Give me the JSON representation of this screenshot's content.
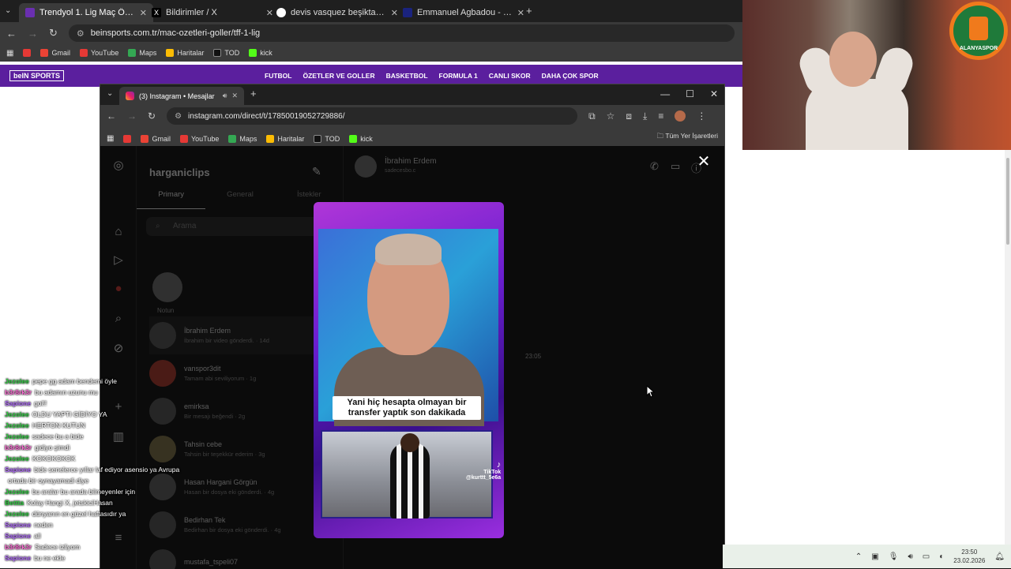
{
  "bg_browser": {
    "tabs": [
      {
        "title": "Trendyol 1. Lig Maç Özetleri ve",
        "color": "#6a2fb0"
      },
      {
        "title": "Bildirimler / X",
        "color": "#000000"
      },
      {
        "title": "devis vasquez beşiktaş - Googl",
        "color": "#4285f4"
      },
      {
        "title": "Emmanuel Agbadou - Oyuncu",
        "color": "#1a237e"
      }
    ],
    "url": "beinsports.com.tr/mac-ozetleri-goller/tff-1-lig",
    "bookmarks": [
      "Gmail",
      "YouTube",
      "Maps",
      "Haritalar",
      "TOD",
      "kick"
    ],
    "site_logo": "beIN SPORTS",
    "nav": [
      "FUTBOL",
      "ÖZETLER VE GOLLER",
      "BASKETBOL",
      "FORMULA 1",
      "CANLI SKOR",
      "DAHA ÇOK SPOR"
    ]
  },
  "ig_window": {
    "tab_title": "(3) Instagram • Mesajlar",
    "url": "instagram.com/direct/t/17850019052729886/",
    "bookmarks": [
      "Gmail",
      "YouTube",
      "Maps",
      "Haritalar",
      "TOD",
      "kick"
    ],
    "all_bookmarks": "Tüm Yer İşaretleri",
    "username": "harganiclips",
    "tabs": [
      "Primary",
      "General",
      "İstekler"
    ],
    "search_placeholder": "Arama",
    "notes_label": "Notun",
    "conversations": [
      {
        "name": "İbrahim Erdem",
        "snippet": "İbrahim bir video gönderdi. · 14d"
      },
      {
        "name": "vanspor3dit",
        "snippet": "Tamam abi seviliyorum · 1g"
      },
      {
        "name": "emirksa",
        "snippet": "Bir mesajı beğendi · 2g"
      },
      {
        "name": "Tahsin cebe",
        "snippet": "Tahsin bir teşekkür ederim · 3g"
      },
      {
        "name": "Hasan Hargani Görgün",
        "snippet": "Hasan bir dosya eki gönderdi. · 4g"
      },
      {
        "name": "Bedirhan Tek",
        "snippet": "Bedirhan bir dosya eki gönderdi. · 4g"
      },
      {
        "name": "mustafa_tspeli07",
        "snippet": ""
      }
    ],
    "chat_name": "İbrahim Erdem",
    "chat_sub": "sadecesbo.c",
    "timestamp": "23:05"
  },
  "video": {
    "caption": "Yani hiç hesapta olmayan bir transfer yaptık son dakikada",
    "tiktok_label": "TikTok",
    "tiktok_user": "@kurttt_5e6a"
  },
  "chat": [
    {
      "user": "Jezolee",
      "color": "#2ecc40",
      "msg": "pepe gg adam bendemi öyle"
    },
    {
      "user": "b3r8rk3r",
      "color": "#ff6bd6",
      "msg": "bu adamın uzunu mu"
    },
    {
      "user": "Sapione",
      "color": "#b36cff",
      "msg": "gol!!"
    },
    {
      "user": "Jezolee",
      "color": "#2ecc40",
      "msg": "OLDU YAPTI GİDİYO YA"
    },
    {
      "user": "Jezolee",
      "color": "#2ecc40",
      "msg": "HERTON KUTUN"
    },
    {
      "user": "Jezolee",
      "color": "#2ecc40",
      "msg": "sadece bu a bide"
    },
    {
      "user": "b3r8rk3r",
      "color": "#ff6bd6",
      "msg": "gidiyo şimdi"
    },
    {
      "user": "Jezolee",
      "color": "#2ecc40",
      "msg": "KOKOKOKOK"
    },
    {
      "user": "Sapione",
      "color": "#b36cff",
      "msg": "bide senelerce yıllar laf ediyor asensio ya Avrupa"
    },
    {
      "user": "",
      "color": "#ffffff",
      "msg": "ortada bir oynayamadi diye"
    },
    {
      "user": "Jezolee",
      "color": "#2ecc40",
      "msg": "bu aralar bu arada bilmeyenler için"
    },
    {
      "user": "Bettta",
      "color": "#2ecc40",
      "msg": "Kolay Hangi X, jetskiciHasan"
    },
    {
      "user": "Jezolee",
      "color": "#2ecc40",
      "msg": "dünyanın en güzel haftasıdır ya"
    },
    {
      "user": "Sapione",
      "color": "#b36cff",
      "msg": "neden"
    },
    {
      "user": "Sapione",
      "color": "#b36cff",
      "msg": "all"
    },
    {
      "user": "b3r8rk3r",
      "color": "#ff6bd6",
      "msg": "Sadece izliyom"
    },
    {
      "user": "Sapione",
      "color": "#b36cff",
      "msg": "bu ne ekle"
    }
  ],
  "taskbar": {
    "time": "23:50",
    "date": "23.02.2026"
  },
  "webcam": {
    "logo_text": "ALANYASPOR"
  }
}
